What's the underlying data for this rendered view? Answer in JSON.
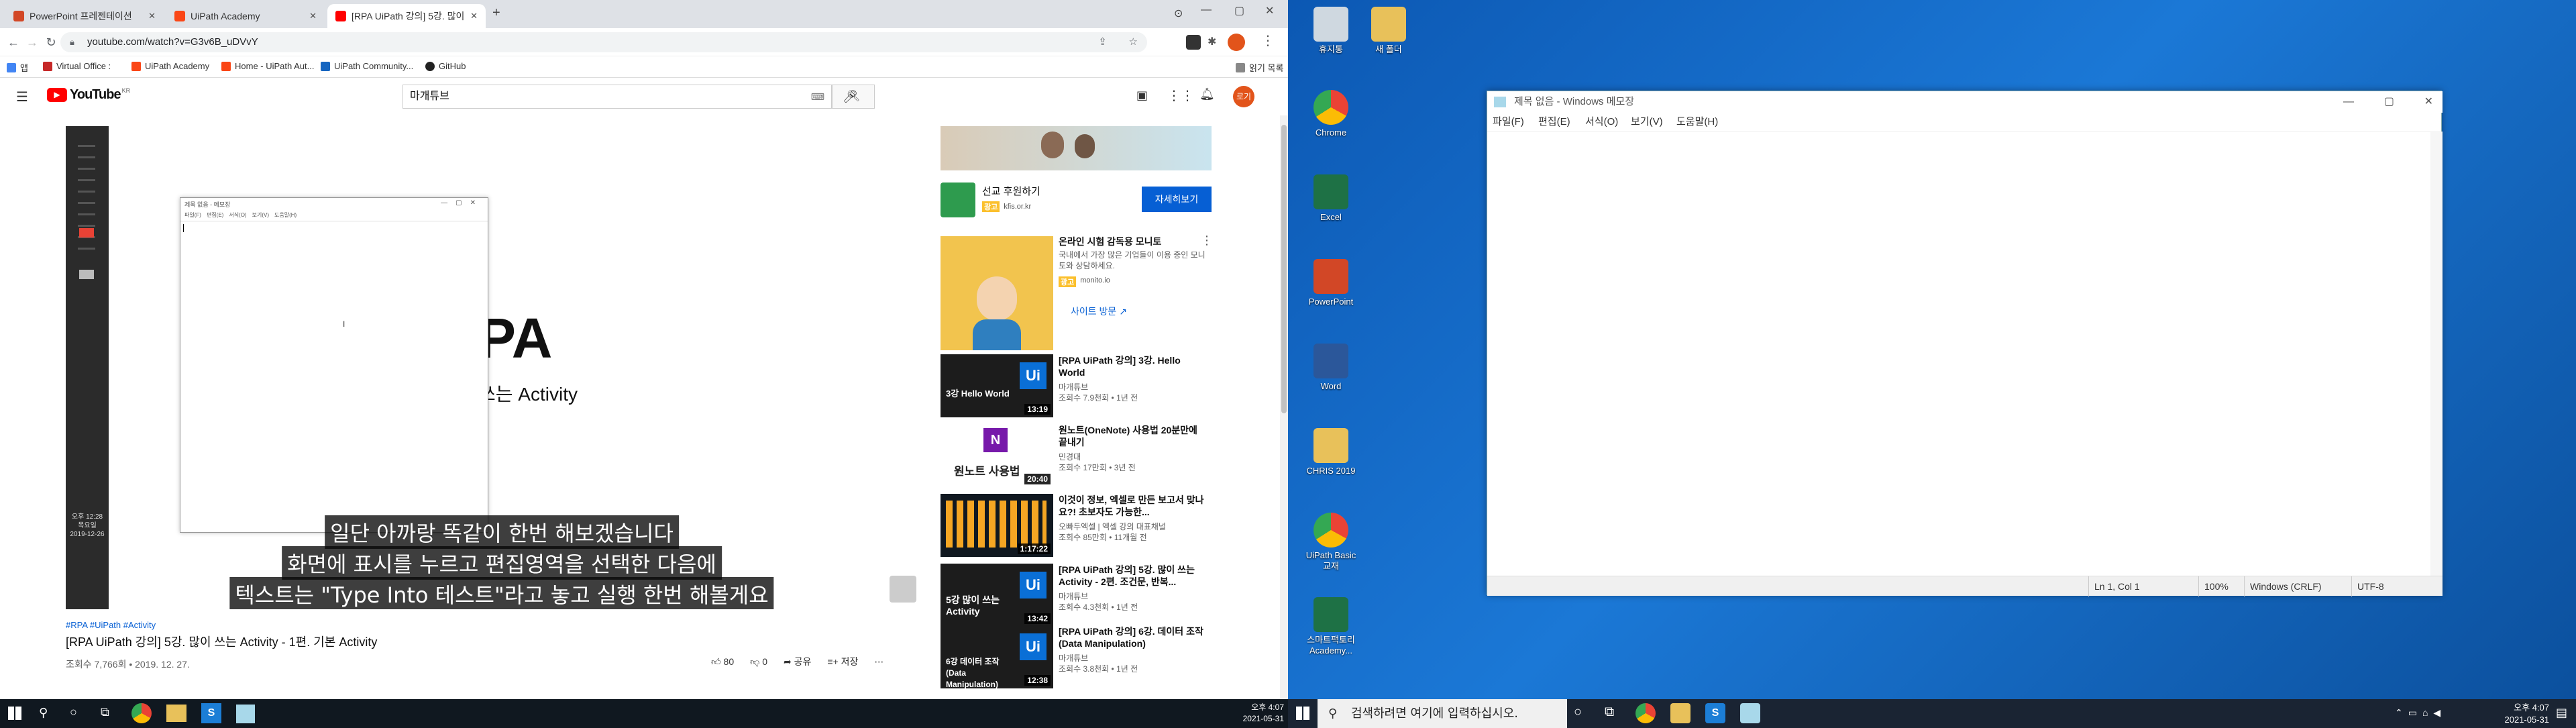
{
  "browser": {
    "tabs": [
      {
        "label": "PowerPoint 프레젠테이션",
        "color": "#d24726"
      },
      {
        "label": "UiPath Academy",
        "color": "#fa4616"
      },
      {
        "label": "[RPA UiPath 강의] 5강. 많이",
        "color": "#ff0000",
        "active": true
      }
    ],
    "url": "youtube.com/watch?v=G3v6B_uDVvY",
    "bookmarks": [
      "앱",
      "Virtual Office :",
      "UiPath Academy",
      "Home - UiPath Aut...",
      "UiPath Community...",
      "GitHub"
    ],
    "reading_list": "읽기 목록"
  },
  "youtube": {
    "logo": "YouTube",
    "country": "KR",
    "search_value": "마개튜브",
    "avatar_text": "로기",
    "video": {
      "big_title_fragment": "PA",
      "big_subtitle_fragment": "쓰는 Activity",
      "subtitles": [
        "일단 아까랑 똑같이 한번 해보겠습니다",
        "화면에 표시를 누르고 편집영역을 선택한 다음에",
        "텍스트는 \"Type Into 테스트\"라고 놓고 실행 한번 해볼게요"
      ],
      "inner_notepad_title": "제목 없음 - 메모장",
      "inner_notepad_menu": [
        "파일(F)",
        "편집(E)",
        "서식(O)",
        "보기(V)",
        "도움말(H)"
      ],
      "sidebar_clock": [
        "오후 12:28",
        "목요일",
        "2019-12-26"
      ]
    },
    "hashtags": "#RPA #UiPath #Activity",
    "title": "[RPA UiPath 강의] 5강. 많이 쓰는 Activity - 1편. 기본 Activity",
    "meta": "조회수 7,766회 • 2019. 12. 27.",
    "likes": "80",
    "dislikes": "0",
    "share": "공유",
    "save": "저장",
    "ad": {
      "name": "선교 후원하기",
      "badge": "광고",
      "domain": "kfis.or.kr",
      "cta": "자세히보기"
    },
    "ad2": {
      "title": "온라인 시험 감독용 모니토",
      "desc": "국내에서 가장 많은 기업들이 이용 중인 모니토와 상담하세요.",
      "badge": "광고",
      "domain": "monito.io",
      "cta": "사이트 방문"
    },
    "related": [
      {
        "title": "[RPA UiPath 강의] 3강. Hello World",
        "channel": "마개튜브",
        "meta": "조회수 7.9천회 • 1년 전",
        "duration": "13:19",
        "thumb_text": "3강 Hello World"
      },
      {
        "title": "원노트(OneNote) 사용법 20분만에 끝내기",
        "channel": "민경대",
        "meta": "조회수 17만회 • 3년 전",
        "duration": "20:40",
        "thumb_text": "원노트 사용법"
      },
      {
        "title": "이것이 정보, 엑셀로 만든 보고서 맞나요?! 초보자도 가능한...",
        "channel": "오빠두엑셀 | 엑셀 강의 대표채널",
        "meta": "조회수 85만회 • 11개월 전",
        "duration": "1:17:22",
        "thumb_text": ""
      },
      {
        "title": "[RPA UiPath 강의] 5강. 많이 쓰는 Activity - 2편. 조건문, 반복...",
        "channel": "마개튜브",
        "meta": "조회수 4.3천회 • 1년 전",
        "duration": "13:42",
        "thumb_text": "5강 많이 쓰는 Activity"
      },
      {
        "title": "[RPA UiPath 강의] 6강. 데이터 조작 (Data Manipulation)",
        "channel": "마개튜브",
        "meta": "조회수 3.8천회 • 1년 전",
        "duration": "12:38",
        "thumb_text": "6강 데이터 조작 (Data Manipulation)"
      }
    ]
  },
  "left_taskbar": {
    "time": "오후 4:07",
    "date": "2021-05-31"
  },
  "desktop": {
    "icons": [
      {
        "label": "휴지통",
        "color": "#cfd8e0"
      },
      {
        "label": "새 폴더",
        "color": "#e8c15a"
      },
      {
        "label": "Chrome",
        "color": "#e94235"
      },
      {
        "label": "Excel",
        "color": "#1e7145"
      },
      {
        "label": "PowerPoint",
        "color": "#d24726"
      },
      {
        "label": "Word",
        "color": "#2b579a"
      },
      {
        "label": "CHRIS 2019",
        "color": "#e8c15a"
      },
      {
        "label": "UiPath Basic 교재",
        "color": "#e94235"
      },
      {
        "label": "스마트팩토리 Academy...",
        "color": "#1e7145"
      }
    ],
    "notepad": {
      "title": "제목 없음 - Windows 메모장",
      "menu": [
        "파일(F)",
        "편집(E)",
        "서식(O)",
        "보기(V)",
        "도움말(H)"
      ],
      "status": {
        "position": "Ln 1, Col 1",
        "zoom": "100%",
        "eol": "Windows (CRLF)",
        "encoding": "UTF-8"
      }
    },
    "taskbar": {
      "search_placeholder": "검색하려면 여기에 입력하십시오.",
      "time": "오후 4:07",
      "date": "2021-05-31"
    }
  }
}
